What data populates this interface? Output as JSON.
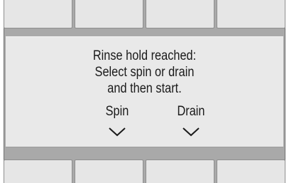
{
  "top_softkeys": [
    {
      "label": ""
    },
    {
      "label": ""
    },
    {
      "label": ""
    },
    {
      "label": ""
    }
  ],
  "bottom_softkeys": [
    {
      "label": ""
    },
    {
      "label": ""
    },
    {
      "label": ""
    },
    {
      "label": ""
    }
  ],
  "display": {
    "message_lines": [
      "Rinse hold reached:",
      "Select spin or drain",
      "and then start."
    ],
    "options": [
      {
        "label": "Spin",
        "icon": "chevron-down-icon"
      },
      {
        "label": "Drain",
        "icon": "chevron-down-icon"
      }
    ]
  },
  "colors": {
    "screen_background": "#e9e9e9",
    "frame": "#a9a9a9",
    "softkey": "#e6e6e6",
    "text": "#1a1a1a"
  }
}
